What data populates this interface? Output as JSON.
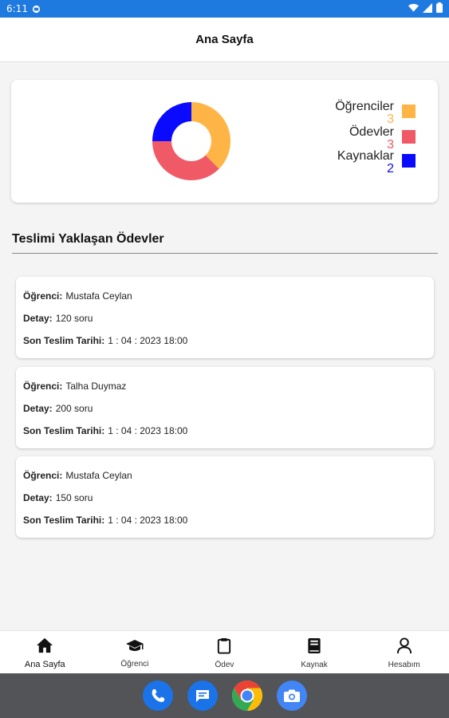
{
  "status_bar": {
    "time": "6:11"
  },
  "app_bar": {
    "title": "Ana Sayfa"
  },
  "chart_data": {
    "type": "pie",
    "categories": [
      "Öğrenciler",
      "Ödevler",
      "Kaynaklar"
    ],
    "values": [
      3,
      3,
      2
    ],
    "colors": [
      "#ffb446",
      "#ef5a66",
      "#0a0aff"
    ],
    "legend_position": "right"
  },
  "legend": [
    {
      "label": "Öğrenciler",
      "value": "3",
      "color": "#ffb446"
    },
    {
      "label": "Ödevler",
      "value": "3",
      "color": "#ef5a66"
    },
    {
      "label": "Kaynaklar",
      "value": "2",
      "color": "#0a0aff"
    }
  ],
  "section": {
    "title": "Teslimi Yaklaşan Ödevler"
  },
  "homework": [
    {
      "student_key": "Öğrenci:",
      "student": "Mustafa  Ceylan",
      "detail_key": "Detay:",
      "detail": "120 soru",
      "due_key": "Son Teslim Tarihi:",
      "due": "1 : 04 : 2023  18:00"
    },
    {
      "student_key": "Öğrenci:",
      "student": "Talha  Duymaz",
      "detail_key": "Detay:",
      "detail": "200 soru",
      "due_key": "Son Teslim Tarihi:",
      "due": "1 : 04 : 2023  18:00"
    },
    {
      "student_key": "Öğrenci:",
      "student": "Mustafa  Ceylan",
      "detail_key": "Detay:",
      "detail": "150 soru",
      "due_key": "Son Teslim Tarihi:",
      "due": "1 : 04 : 2023  18:00"
    }
  ],
  "bottom_nav": [
    {
      "label": "Ana Sayfa",
      "icon": "home-icon"
    },
    {
      "label": "Öğrenci",
      "icon": "graduation-cap-icon"
    },
    {
      "label": "Ödev",
      "icon": "clipboard-icon"
    },
    {
      "label": "Kaynak",
      "icon": "book-icon"
    },
    {
      "label": "Hesabım",
      "icon": "person-icon"
    }
  ],
  "dock": [
    {
      "icon": "phone-icon",
      "color": "#1a73e8"
    },
    {
      "icon": "messages-icon",
      "color": "#1a73e8"
    },
    {
      "icon": "chrome-icon",
      "color": "#ffffff"
    },
    {
      "icon": "camera-icon",
      "color": "#4285f4"
    }
  ]
}
